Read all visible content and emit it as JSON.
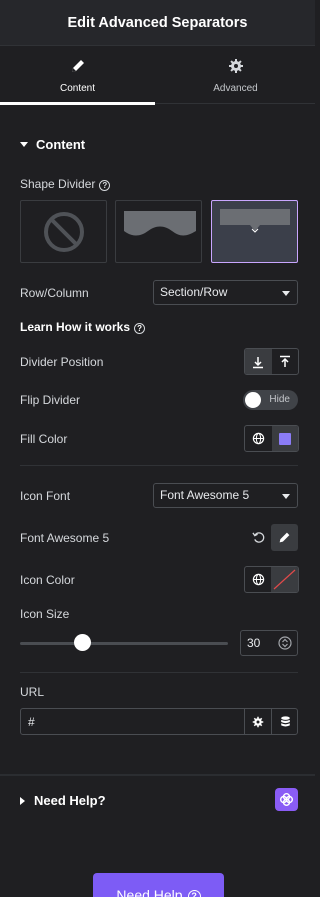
{
  "header": {
    "title": "Edit Advanced Separators"
  },
  "tabs": [
    {
      "label": "Content",
      "icon": "pencil-icon",
      "active": true
    },
    {
      "label": "Advanced",
      "icon": "gear-icon",
      "active": false
    }
  ],
  "content_section": {
    "title": "Content",
    "shape_divider": {
      "label": "Shape Divider",
      "options": [
        "none-icon",
        "curve-divider-icon",
        "arrow-divider-icon"
      ],
      "selected_index": 2
    },
    "row_column": {
      "label": "Row/Column",
      "value": "Section/Row"
    },
    "learn_link": "Learn How it works",
    "divider_position": {
      "label": "Divider Position",
      "options": [
        "align-bottom-icon",
        "align-top-icon"
      ]
    },
    "flip_divider": {
      "label": "Flip Divider",
      "toggle_label": "Hide",
      "on": false
    },
    "fill_color": {
      "label": "Fill Color",
      "swatch": "#8b7cf6"
    },
    "icon_font": {
      "label": "Icon Font",
      "value": "Font Awesome 5"
    },
    "font_awesome": {
      "label": "Font Awesome 5"
    },
    "icon_color": {
      "label": "Icon Color"
    },
    "icon_size": {
      "label": "Icon Size",
      "value": "30",
      "slider_fraction": 0.3
    },
    "url": {
      "label": "URL",
      "value": "#"
    }
  },
  "help_section": {
    "title": "Need Help?",
    "button_label": "Need Help"
  },
  "colors": {
    "accent": "#7d5cf5",
    "background": "#1f1f22",
    "selected_border": "#c9a6ff"
  }
}
